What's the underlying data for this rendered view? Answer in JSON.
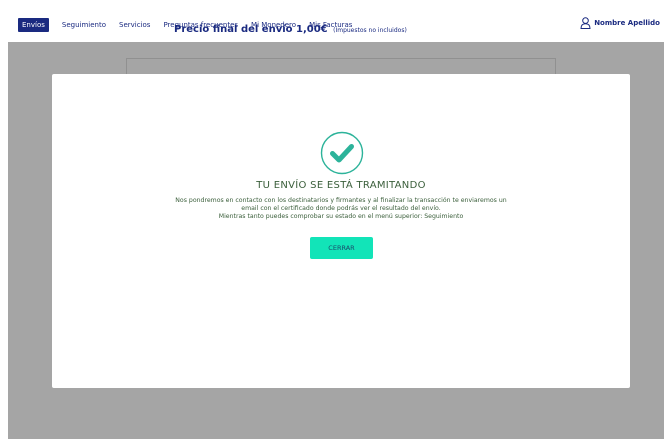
{
  "nav": {
    "items": [
      "Envíos",
      "Seguimiento",
      "Servicios",
      "Preguntas frecuentes",
      "Mi Monedero",
      "Mis Facturas"
    ],
    "active_index": 0
  },
  "user": {
    "name": "Nombre Apellido",
    "icon": "user-icon"
  },
  "page": {
    "price_label": "Precio final del envío 1,00€",
    "price_note": "(Impuestos no incluidos)"
  },
  "modal": {
    "icon": "check-circle-icon",
    "title": "TU ENVÍO SE ESTÁ TRAMITANDO",
    "line1": "Nos pondremos en contacto con los destinatarios y firmantes y al finalizar la transacción te enviaremos un",
    "line2": "email con el certificado donde podrás ver el resultado del envío.",
    "line3": "Mientras tanto puedes comprobar su estado en el menú superior: Seguimiento",
    "close_label": "CERRAR"
  },
  "colors": {
    "nav_blue": "#1a2a80",
    "accent_teal": "#2cb39a",
    "button": "#12e4b8",
    "text_green": "#3a5e3a",
    "overlay": "#6e6e6e"
  }
}
